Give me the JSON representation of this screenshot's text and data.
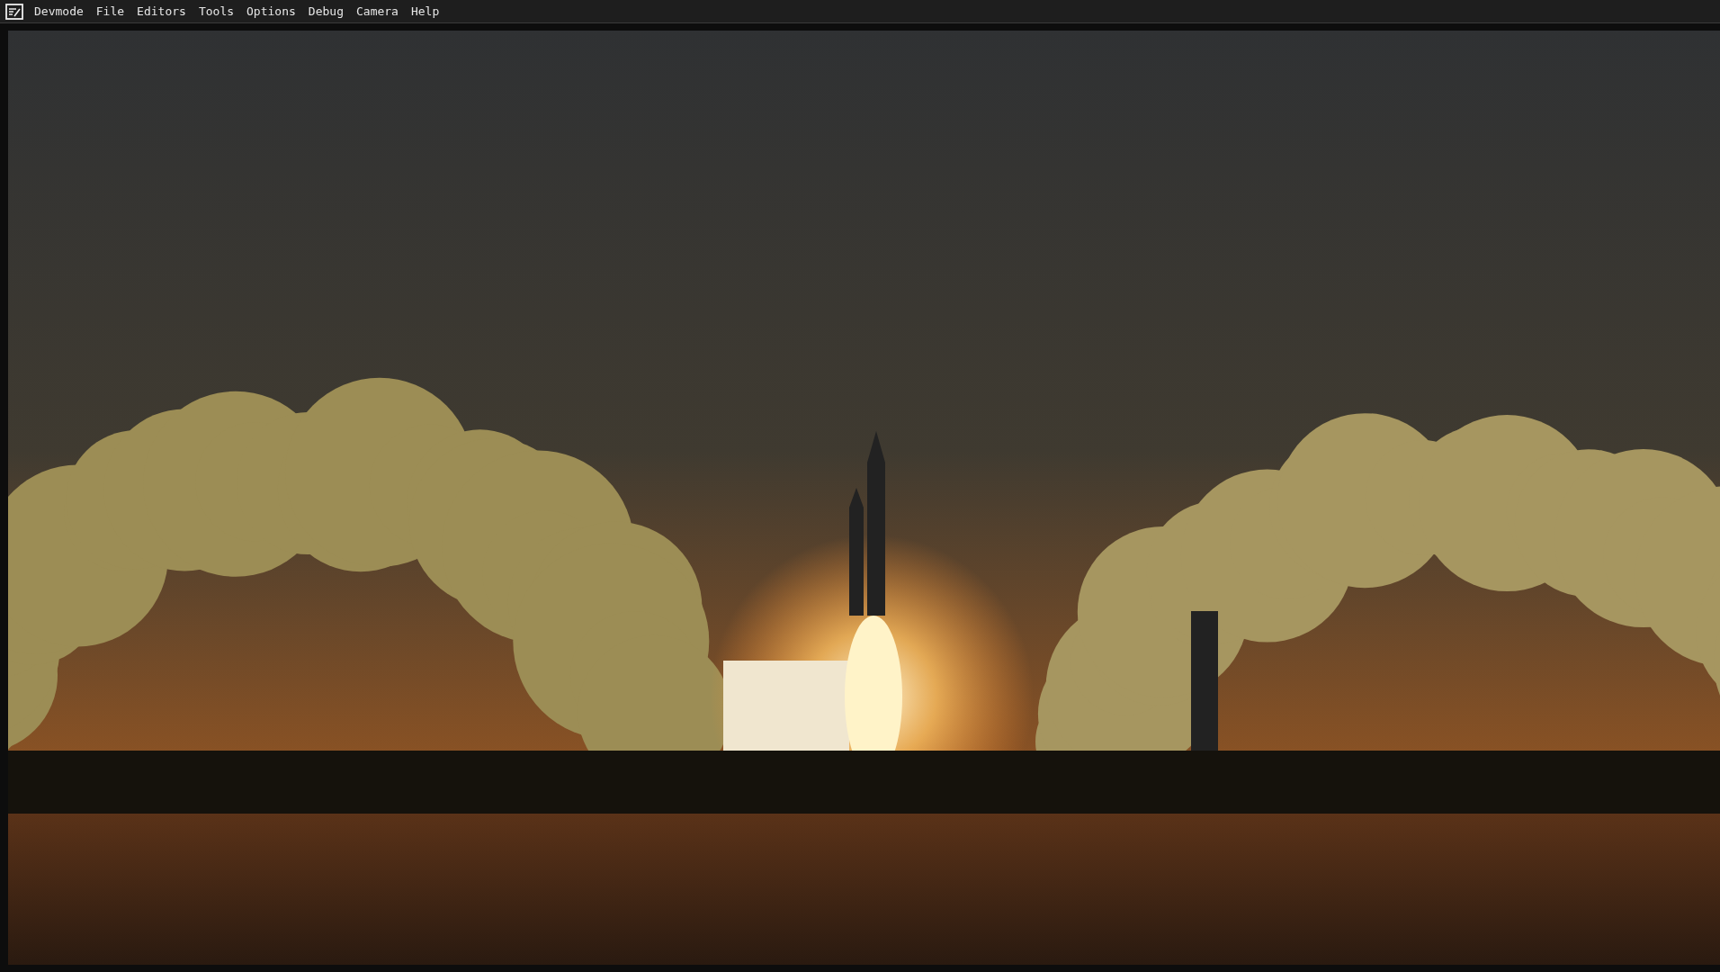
{
  "menu_bar": {
    "items": [
      "Devmode",
      "File",
      "Editors",
      "Tools",
      "Options",
      "Debug",
      "Camera",
      "Help"
    ]
  }
}
